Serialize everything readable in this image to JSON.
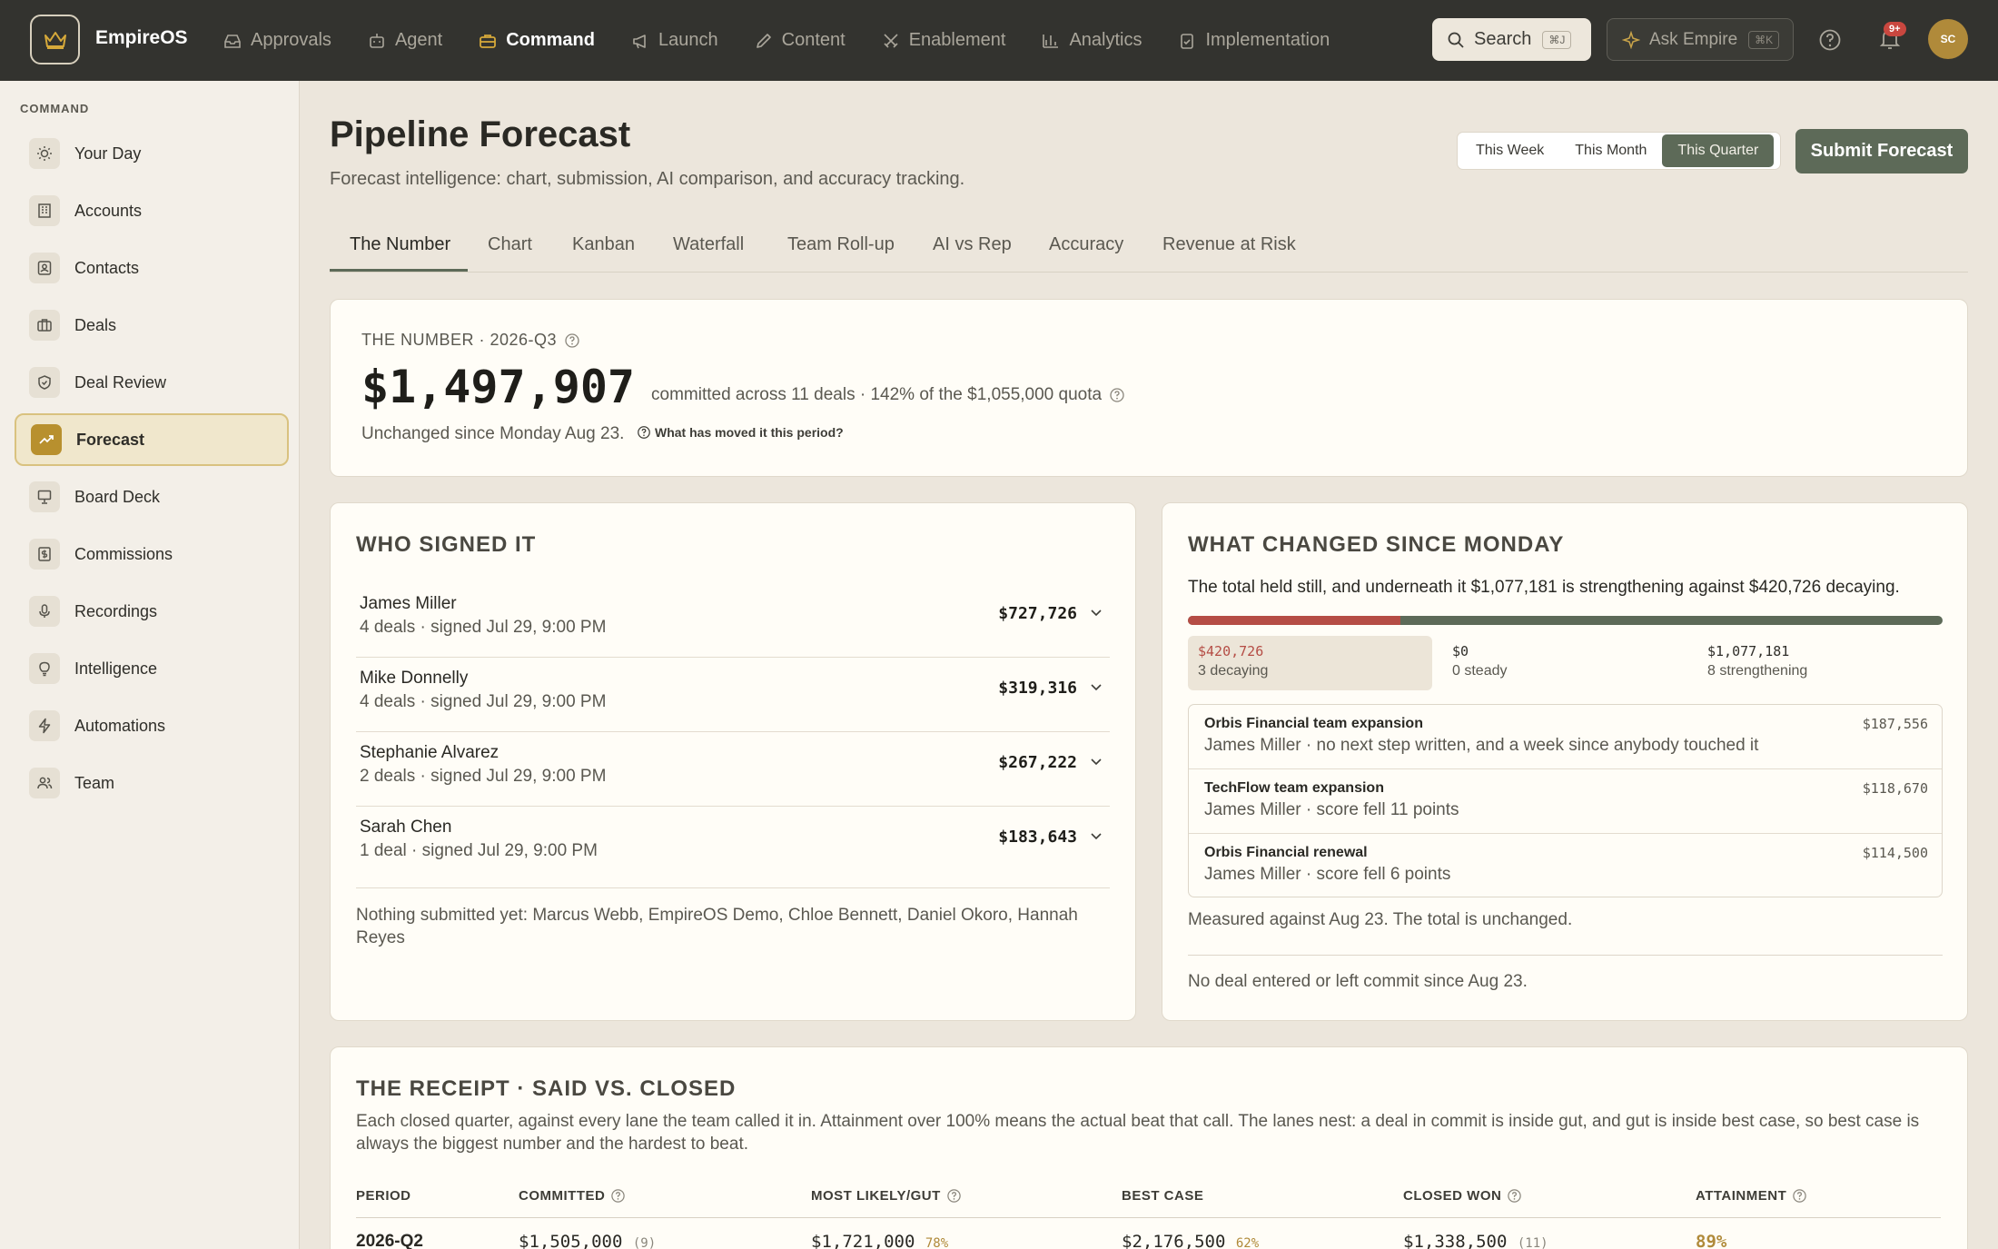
{
  "app": {
    "name": "EmpireOS"
  },
  "topnav": [
    {
      "label": "Approvals",
      "icon": "inbox-icon"
    },
    {
      "label": "Agent",
      "icon": "robot-icon"
    },
    {
      "label": "Command",
      "icon": "briefcase-icon",
      "active": true
    },
    {
      "label": "Launch",
      "icon": "megaphone-icon"
    },
    {
      "label": "Content",
      "icon": "pencil-icon"
    },
    {
      "label": "Enablement",
      "icon": "swords-icon"
    },
    {
      "label": "Analytics",
      "icon": "bar-chart-icon"
    },
    {
      "label": "Implementation",
      "icon": "clipboard-check-icon"
    }
  ],
  "search": {
    "label": "Search",
    "shortcut": "⌘J"
  },
  "ask": {
    "label": "Ask Empire",
    "shortcut": "⌘K"
  },
  "notifications": {
    "count": "9+"
  },
  "user": {
    "initials": "SC"
  },
  "sidebar": {
    "heading": "COMMAND",
    "items": [
      {
        "label": "Your Day",
        "icon": "sun-icon"
      },
      {
        "label": "Accounts",
        "icon": "building-icon"
      },
      {
        "label": "Contacts",
        "icon": "contact-card-icon"
      },
      {
        "label": "Deals",
        "icon": "briefcase-icon"
      },
      {
        "label": "Deal Review",
        "icon": "shield-check-icon"
      },
      {
        "label": "Forecast",
        "icon": "trending-up-icon",
        "active": true
      },
      {
        "label": "Board Deck",
        "icon": "presentation-icon"
      },
      {
        "label": "Commissions",
        "icon": "dollar-receipt-icon"
      },
      {
        "label": "Recordings",
        "icon": "microphone-icon"
      },
      {
        "label": "Intelligence",
        "icon": "lightbulb-icon"
      },
      {
        "label": "Automations",
        "icon": "lightning-icon"
      },
      {
        "label": "Team",
        "icon": "users-icon"
      }
    ]
  },
  "header": {
    "title": "Pipeline Forecast",
    "subtitle": "Forecast intelligence: chart, submission, AI comparison, and accuracy tracking.",
    "ranges": [
      "This Week",
      "This Month",
      "This Quarter"
    ],
    "active_range": "This Quarter",
    "submit_label": "Submit Forecast"
  },
  "tabs": [
    "The Number",
    "Chart",
    "Kanban",
    "Waterfall",
    "Team Roll-up",
    "AI vs Rep",
    "Accuracy",
    "Revenue at Risk"
  ],
  "the_number": {
    "label": "THE NUMBER · 2026-Q3",
    "value": "$1,497,907",
    "note": "committed across 11 deals · 142% of the $1,055,000 quota",
    "since": "Unchanged since Monday Aug 23.",
    "moved_link": "What has moved it this period?"
  },
  "who_signed": {
    "title": "WHO SIGNED IT",
    "signers": [
      {
        "name": "James Miller",
        "detail": "4 deals · signed Jul 29, 9:00 PM",
        "amount": "$727,726"
      },
      {
        "name": "Mike Donnelly",
        "detail": "4 deals · signed Jul 29, 9:00 PM",
        "amount": "$319,316"
      },
      {
        "name": "Stephanie Alvarez",
        "detail": "2 deals · signed Jul 29, 9:00 PM",
        "amount": "$267,222"
      },
      {
        "name": "Sarah Chen",
        "detail": "1 deal · signed Jul 29, 9:00 PM",
        "amount": "$183,643"
      }
    ],
    "nothing": "Nothing submitted yet: Marcus Webb, EmpireOS Demo, Chloe Bennett, Daniel Okoro, Hannah Reyes"
  },
  "what_changed": {
    "title": "WHAT CHANGED SINCE MONDAY",
    "summary": "The total held still, and underneath it $1,077,181 is strengthening against $420,726 decaying.",
    "decaying_fraction": 0.281,
    "legend": {
      "decaying": {
        "value": "$420,726",
        "label": "3 decaying"
      },
      "steady": {
        "value": "$0",
        "label": "0 steady"
      },
      "strengthening": {
        "value": "$1,077,181",
        "label": "8 strengthening"
      }
    },
    "changes": [
      {
        "title": "Orbis Financial team expansion",
        "detail": "James Miller · no next step written, and a week since anybody touched it",
        "amount": "$187,556"
      },
      {
        "title": "TechFlow team expansion",
        "detail": "James Miller · score fell 11 points",
        "amount": "$118,670"
      },
      {
        "title": "Orbis Financial renewal",
        "detail": "James Miller · score fell 6 points",
        "amount": "$114,500"
      }
    ],
    "measured": "Measured against Aug 23. The total is unchanged.",
    "no_entry": "No deal entered or left commit since Aug 23."
  },
  "receipt": {
    "title": "THE RECEIPT · SAID VS. CLOSED",
    "subtitle": "Each closed quarter, against every lane the team called it in. Attainment over 100% means the actual beat that call. The lanes nest: a deal in commit is inside gut, and gut is inside best case, so best case is always the biggest number and the hardest to beat.",
    "columns": [
      "PERIOD",
      "COMMITTED",
      "MOST LIKELY/GUT",
      "BEST CASE",
      "CLOSED WON",
      "ATTAINMENT"
    ],
    "rows": [
      {
        "period": "2026-Q2",
        "committed": "$1,505,000",
        "committed_count": "(9)",
        "gut": "$1,721,000",
        "gut_pct": "78%",
        "best": "$2,176,500",
        "best_pct": "62%",
        "won": "$1,338,500",
        "won_count": "(11)",
        "attainment": "89%"
      }
    ]
  },
  "colors": {
    "accent": "#5d6a58",
    "gold": "#b8902e",
    "decay": "#b54d45",
    "topbar": "#33332f"
  }
}
